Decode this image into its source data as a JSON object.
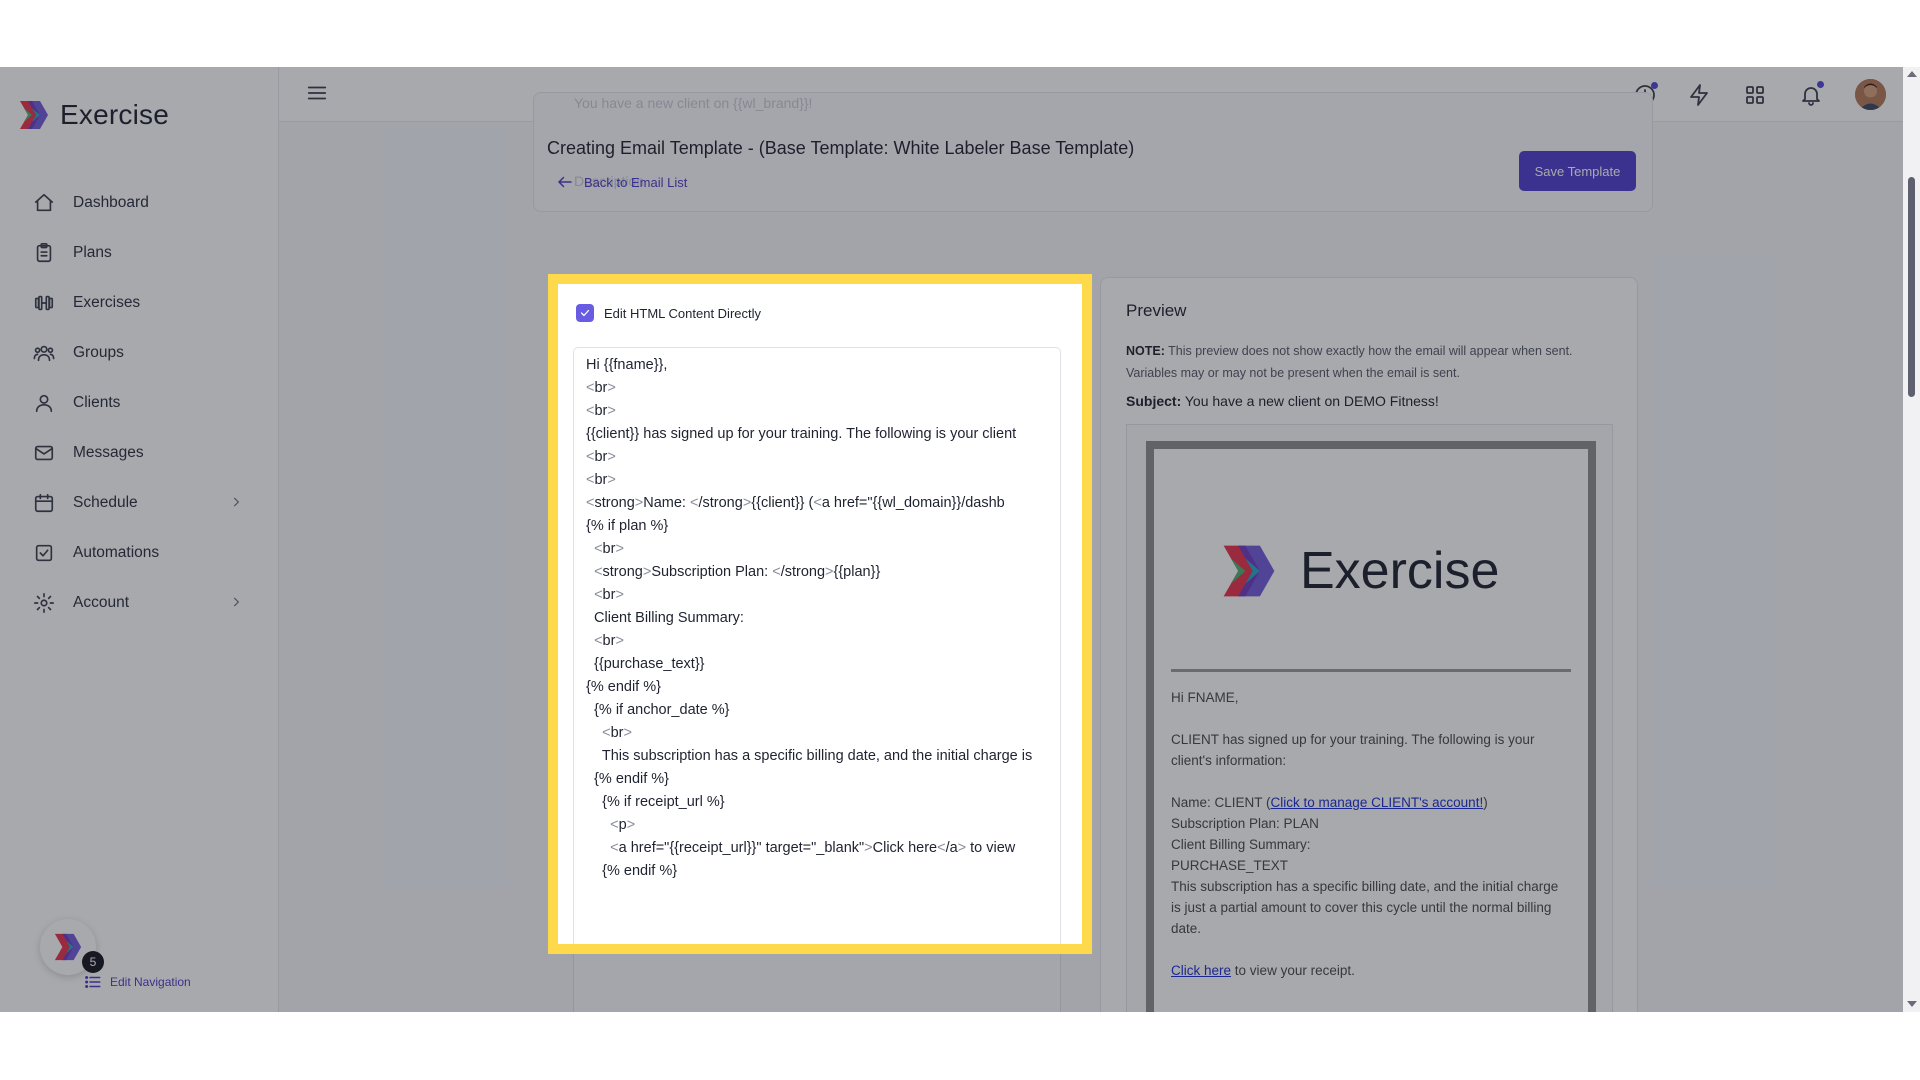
{
  "app": {
    "brand": "Exercise"
  },
  "sidebar": {
    "items": [
      {
        "label": "Dashboard",
        "icon": "home-icon",
        "chevron": false
      },
      {
        "label": "Plans",
        "icon": "clipboard-icon",
        "chevron": false
      },
      {
        "label": "Exercises",
        "icon": "dumbbell-icon",
        "chevron": false
      },
      {
        "label": "Groups",
        "icon": "users-group-icon",
        "chevron": false
      },
      {
        "label": "Clients",
        "icon": "user-icon",
        "chevron": false
      },
      {
        "label": "Messages",
        "icon": "mail-icon",
        "chevron": false
      },
      {
        "label": "Schedule",
        "icon": "calendar-icon",
        "chevron": true
      },
      {
        "label": "Automations",
        "icon": "checkbox-icon",
        "chevron": false
      },
      {
        "label": "Account",
        "icon": "gear-icon",
        "chevron": true
      }
    ],
    "badge_count": "5",
    "edit_navigation": "Edit Navigation"
  },
  "topbar": {
    "icons": [
      "history-icon",
      "bolt-icon",
      "grid-icon",
      "bell-icon",
      "user-avatar"
    ]
  },
  "header": {
    "title": "Creating Email Template - (Base Template: White Labeler Base Template)",
    "back_link": "Back to Email List",
    "save_button": "Save Template",
    "faint_subject": "You have a new client on {{wl_brand}}!",
    "faint_description": "Description"
  },
  "editor": {
    "checkbox_label": "Edit HTML Content Directly",
    "checked": true,
    "lines": [
      "Hi {{fname}},",
      "<br>",
      "<br>",
      "{{client}} has signed up for your training. The following is your client",
      "<br>",
      "<br>",
      "<strong>Name: </strong>{{client}} (<a href=\"{{wl_domain}}/dashb",
      "{% if plan %}",
      "  <br>",
      "  <strong>Subscription Plan: </strong>{{plan}}",
      "  <br>",
      "  Client Billing Summary:",
      "  <br>",
      "  {{purchase_text}}",
      "{% endif %}",
      "  {% if anchor_date %}",
      "    <br>",
      "    This subscription has a specific billing date, and the initial charge is",
      "  {% endif %}",
      "    {% if receipt_url %}",
      "      <p>",
      "      <a href=\"{{receipt_url}}\" target=\"_blank\">Click here</a> to view",
      "    {% endif %}"
    ]
  },
  "preview": {
    "title": "Preview",
    "note_label": "NOTE:",
    "note_text": "This preview does not show exactly how the email will appear when sent. Variables may or may not be present when the email is sent.",
    "subject_label": "Subject:",
    "subject_text": "You have a new client on DEMO Fitness!",
    "email_brand": "Exercise",
    "greeting": "Hi FNAME,",
    "intro": "CLIENT has signed up for your training. The following is your client's information:",
    "name_line_prefix": "Name: CLIENT (",
    "name_link": "Click to manage CLIENT's account!",
    "name_line_suffix": ")",
    "plan_line": "Subscription Plan: PLAN",
    "billing_label": "Client Billing Summary:",
    "purchase_text": "PURCHASE_TEXT",
    "billing_note": "This subscription has a specific billing date, and the initial charge is just a partial amount to cover this cycle until the normal billing date.",
    "receipt_link": "Click here",
    "receipt_suffix": "to view your receipt."
  },
  "colors": {
    "accent": "#4f3fd0",
    "highlight": "#fed94b",
    "link": "#1c2fd1"
  }
}
